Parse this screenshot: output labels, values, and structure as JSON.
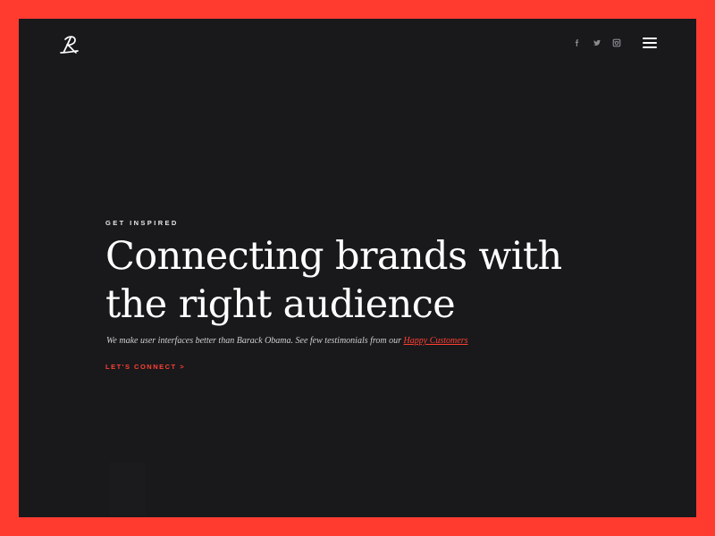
{
  "colors": {
    "frame": "#ff3b30",
    "background": "#19191c",
    "accent": "#ff4032",
    "text": "#ffffff",
    "muted": "#cfcfcf",
    "icon": "#8a8a8f"
  },
  "header": {
    "logo_icon": "signature-logo-icon",
    "social": [
      {
        "name": "facebook-icon"
      },
      {
        "name": "twitter-icon"
      },
      {
        "name": "instagram-icon"
      }
    ],
    "menu_icon": "hamburger-menu-icon"
  },
  "hero": {
    "eyebrow": "GET INSPIRED",
    "headline_line1": "Connecting brands with",
    "headline_line2": "the right audience",
    "subcopy": "We make user interfaces better than Barack Obama. See few testimonials from our ",
    "link_text": "Happy Customers",
    "cta": "LET'S CONNECT >"
  }
}
